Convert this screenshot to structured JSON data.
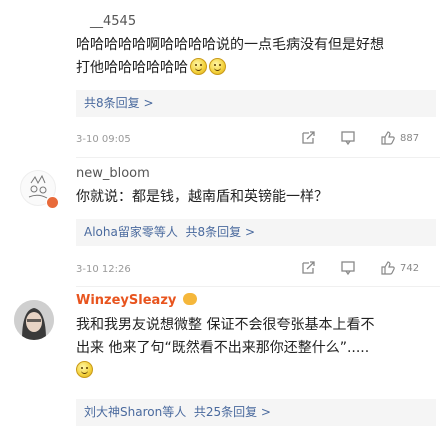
{
  "comments": [
    {
      "username": "__4545",
      "line1": "哈哈哈哈哈啊哈哈哈哈说的一点毛病没有但是好想",
      "line2": "打他哈哈哈哈哈哈",
      "replies_text": "共8条回复 >",
      "timestamp": "3-10 09:05",
      "likes": "887"
    },
    {
      "username": "new_bloom",
      "line1": "你就说：都是钱，越南盾和英镑能一样？",
      "replies_names": "Aloha留家零等人",
      "replies_text": "共8条回复 >",
      "timestamp": "3-10 12:26",
      "likes": "742"
    },
    {
      "username": "WinzeySleazy",
      "line1": "我和我男友说想微整 保证不会很夸张基本上看不",
      "line2": "出来 他来了句“既然看不出来那你还整什么”.....",
      "replies_names": "刘大神Sharon等人",
      "replies_text": "共25条回复 >"
    }
  ]
}
